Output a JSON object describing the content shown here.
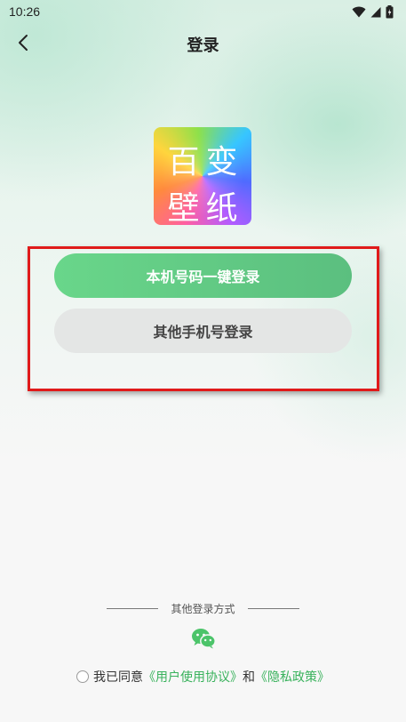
{
  "status_bar": {
    "time": "10:26",
    "icons": [
      "wifi-icon",
      "cell-signal-icon",
      "battery-icon"
    ]
  },
  "nav": {
    "back_icon": "chevron-left-icon",
    "title": "登录"
  },
  "logo": {
    "chars": [
      "百",
      "变",
      "壁",
      "纸"
    ]
  },
  "buttons": {
    "one_click_login": "本机号码一键登录",
    "other_phone_login": "其他手机号登录"
  },
  "other_methods": {
    "label": "其他登录方式",
    "wechat_icon": "wechat-icon"
  },
  "agreement": {
    "prefix": "我已同意",
    "user_agreement": "《用户使用协议》",
    "conjunction": "和",
    "privacy_policy": "《隐私政策》"
  },
  "colors": {
    "accent_green": "#5bbf7f",
    "link_green": "#39b25c",
    "highlight_red": "#e01a1a"
  }
}
